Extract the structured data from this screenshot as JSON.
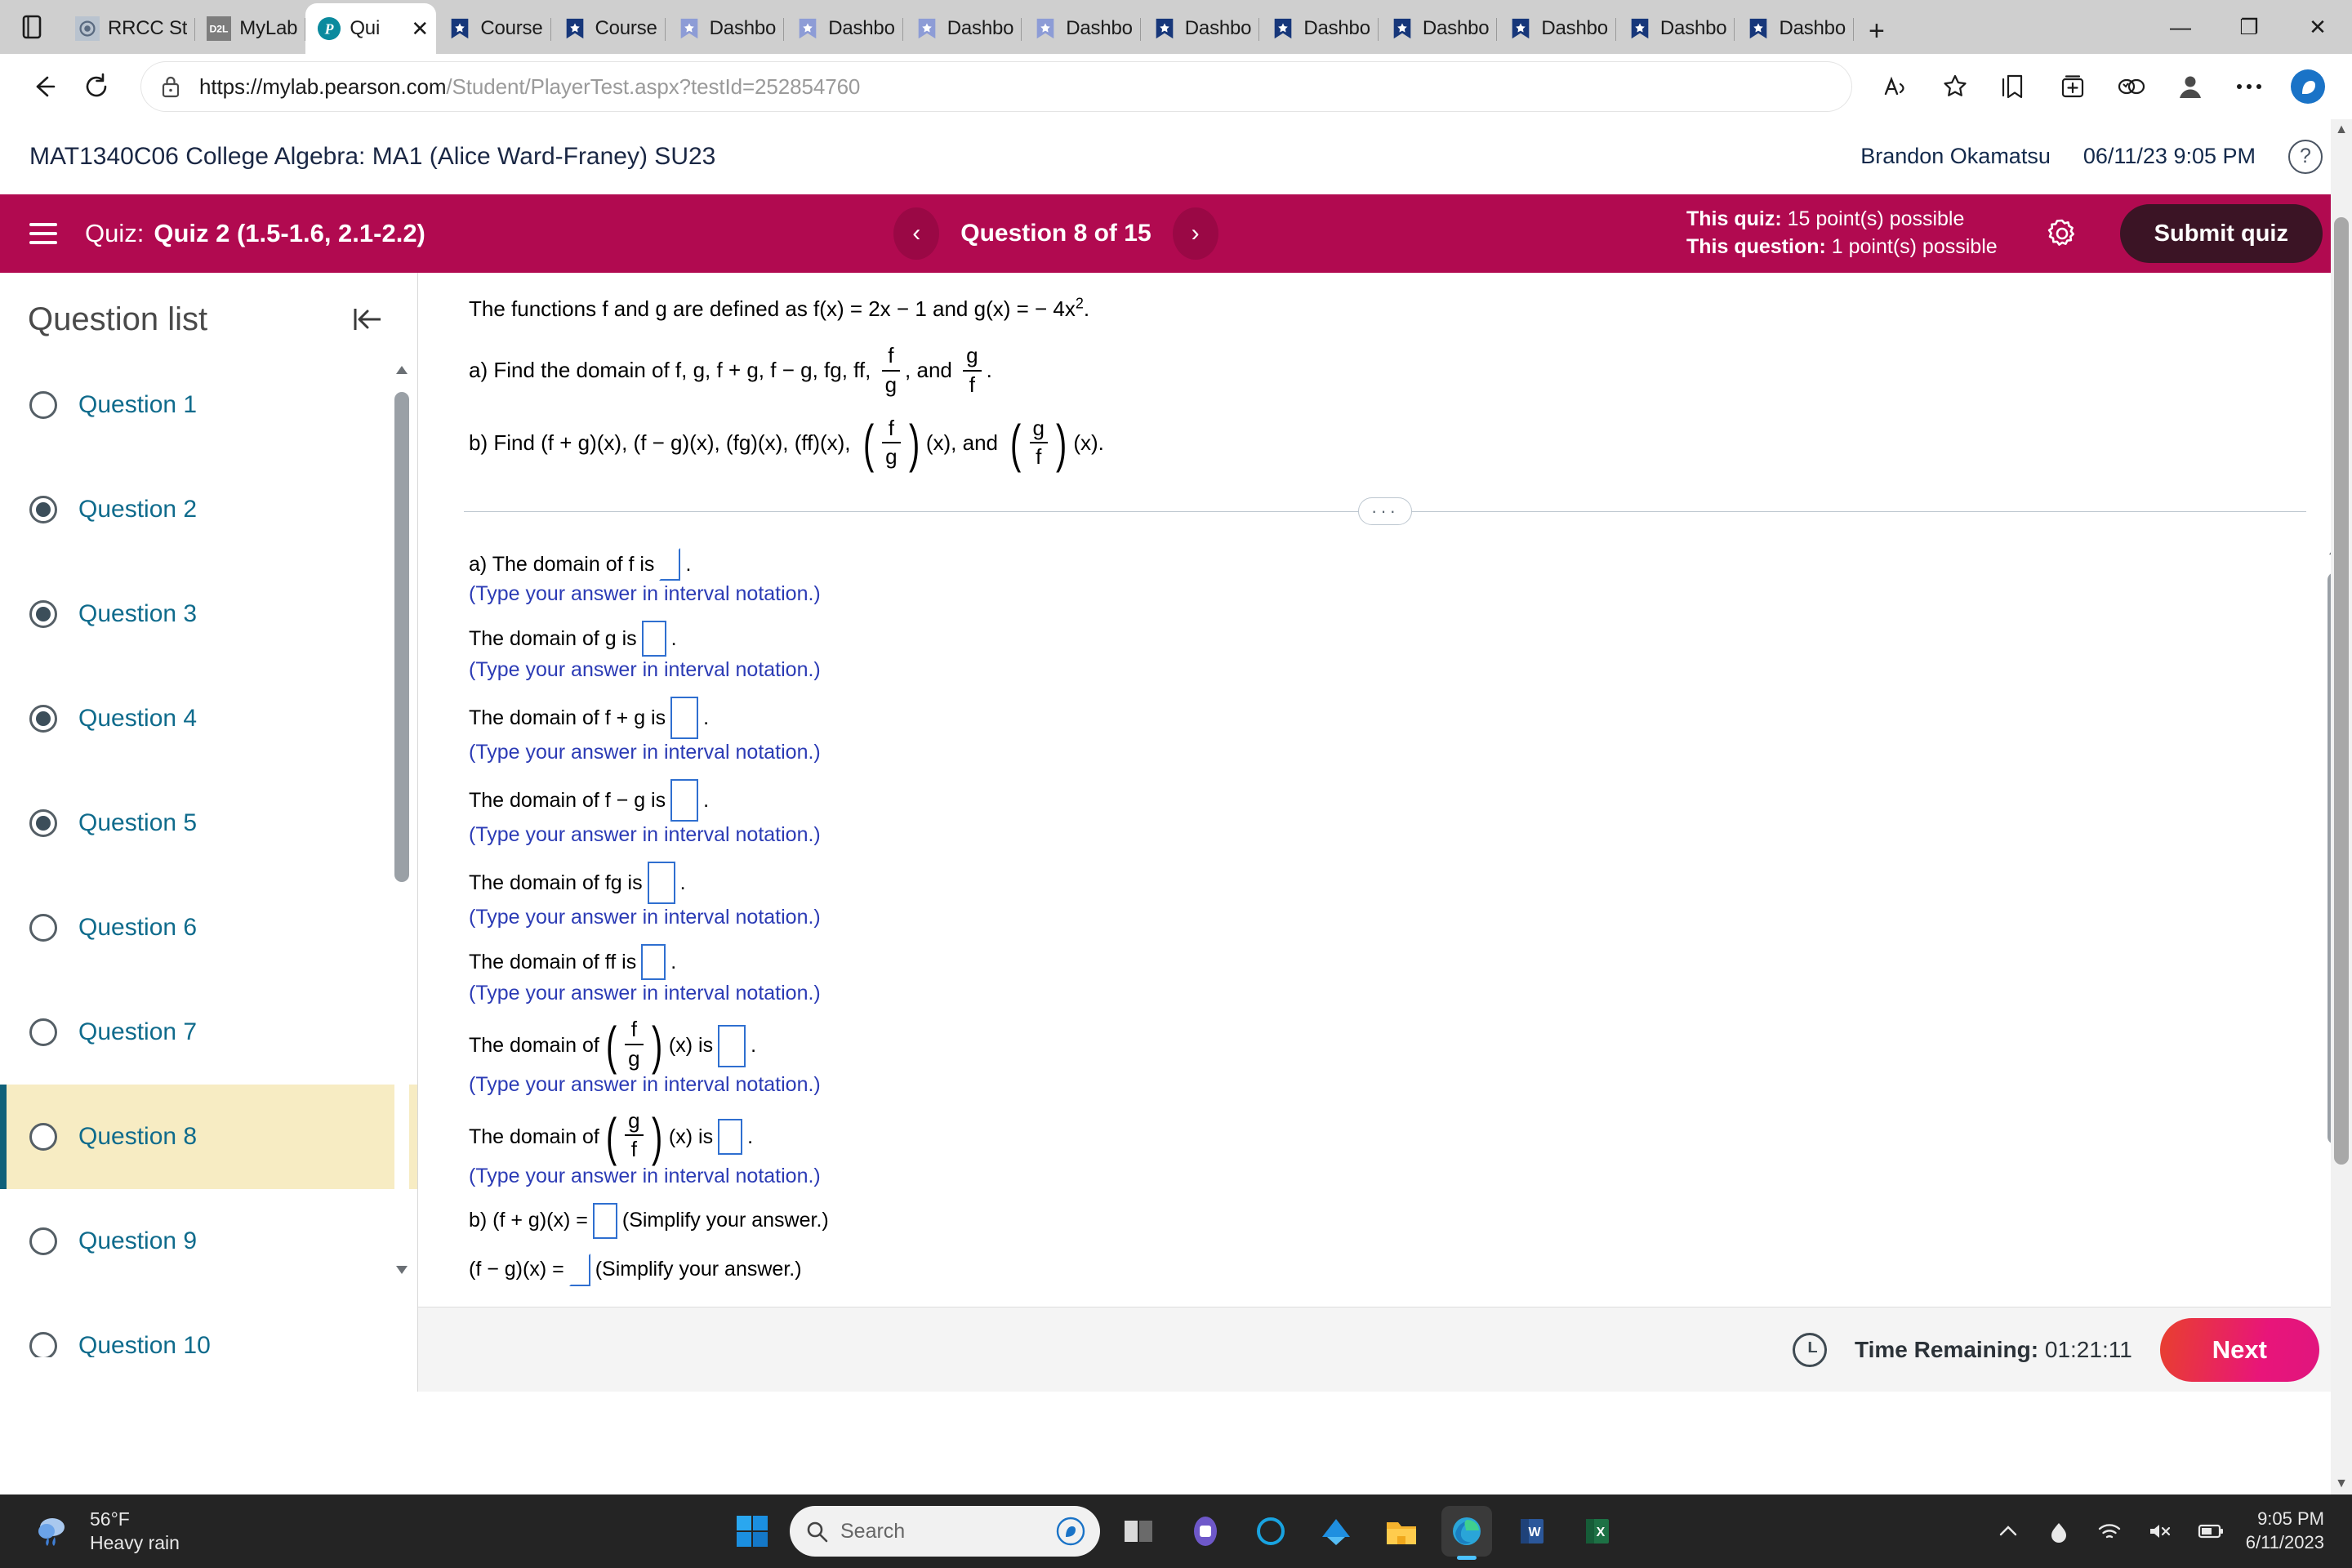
{
  "browser": {
    "tabs": [
      {
        "label": "RRCC St",
        "favicon": "rrcc-seal-icon",
        "active": false
      },
      {
        "label": "MyLab ",
        "favicon": "d2l-icon",
        "active": false
      },
      {
        "label": "Qui",
        "favicon": "pearson-p-icon",
        "active": true
      },
      {
        "label": "Course ",
        "favicon": "blue-banner-icon",
        "active": false
      },
      {
        "label": "Course",
        "favicon": "blue-banner-icon",
        "active": false
      },
      {
        "label": "Dashbo",
        "favicon": "lightblue-banner-icon",
        "active": false
      },
      {
        "label": "Dashbo",
        "favicon": "lightblue-banner-icon",
        "active": false
      },
      {
        "label": "Dashbo",
        "favicon": "lightblue-banner-icon",
        "active": false
      },
      {
        "label": "Dashbo",
        "favicon": "lightblue-banner-icon",
        "active": false
      },
      {
        "label": "Dashbo",
        "favicon": "blue-banner-icon",
        "active": false
      },
      {
        "label": "Dashbo",
        "favicon": "blue-banner-icon",
        "active": false
      },
      {
        "label": "Dashbo",
        "favicon": "blue-banner-icon",
        "active": false
      },
      {
        "label": "Dashbo",
        "favicon": "blue-banner-icon",
        "active": false
      },
      {
        "label": "Dashbo",
        "favicon": "blue-banner-icon",
        "active": false
      },
      {
        "label": "Dashbo",
        "favicon": "blue-banner-icon",
        "active": false
      }
    ],
    "new_tab_label": "+",
    "window_controls": {
      "minimize": "—",
      "maximize": "❐",
      "close": "✕"
    },
    "url_host": "https://mylab.pearson.com",
    "url_path": "/Student/PlayerTest.aspx?testId=252854760",
    "url_full": "https://mylab.pearson.com/Student/PlayerTest.aspx?testId=252854760"
  },
  "course_header": {
    "title": "MAT1340C06 College Algebra: MA1 (Alice Ward-Franey) SU23",
    "user": "Brandon Okamatsu",
    "datetime": "06/11/23 9:05 PM",
    "help_glyph": "?"
  },
  "quiz_bar": {
    "quiz_label": "Quiz:",
    "quiz_name": "Quiz 2 (1.5-1.6, 2.1-2.2)",
    "prev_glyph": "‹",
    "question_counter": "Question 8 of 15",
    "next_glyph": "›",
    "points_quiz_label": "This quiz:",
    "points_quiz_value": " 15 point(s) possible",
    "points_question_label": "This question:",
    "points_question_value": " 1 point(s) possible",
    "submit_label": "Submit quiz",
    "accent_color": "#b10a50",
    "submit_color": "#3b1425"
  },
  "sidebar": {
    "title": "Question list",
    "collapse_glyph": "⇤",
    "questions": [
      {
        "label": "Question 1",
        "answered": false,
        "current": false
      },
      {
        "label": "Question 2",
        "answered": true,
        "current": false
      },
      {
        "label": "Question 3",
        "answered": true,
        "current": false
      },
      {
        "label": "Question 4",
        "answered": true,
        "current": false
      },
      {
        "label": "Question 5",
        "answered": true,
        "current": false
      },
      {
        "label": "Question 6",
        "answered": false,
        "current": false
      },
      {
        "label": "Question 7",
        "answered": false,
        "current": false
      },
      {
        "label": "Question 8",
        "answered": false,
        "current": true
      },
      {
        "label": "Question 9",
        "answered": false,
        "current": false
      },
      {
        "label": "Question 10",
        "answered": false,
        "current": false
      }
    ],
    "highlight_color": "#f7ecc3",
    "current_marker_color": "#10617a",
    "link_color": "#0f6b8c"
  },
  "question": {
    "stem_1_pre": "The functions f and g are defined as f(x) = 2x − 1 and g(x) = − 4x",
    "stem_1_sup": "2",
    "stem_1_post": ".",
    "stem_2_pre": "a) Find the domain of f, g, f + g, f − g, fg, ff, ",
    "stem_2_frac1_num": "f",
    "stem_2_frac1_den": "g",
    "stem_2_mid": ", and ",
    "stem_2_frac2_num": "g",
    "stem_2_frac2_den": "f",
    "stem_2_post": ".",
    "stem_3_pre": "b) Find (f + g)(x), (f − g)(x), (fg)(x), (ff)(x), ",
    "stem_3_frac1_num": "f",
    "stem_3_frac1_den": "g",
    "stem_3_mid": "(x), and ",
    "stem_3_frac2_num": "g",
    "stem_3_frac2_den": "f",
    "stem_3_post": "(x).",
    "collapse_dots": "···"
  },
  "answers": {
    "interval_hint": "(Type your answer in interval notation.)",
    "simplify_hint": "(Simplify your answer.)",
    "rows": [
      {
        "label_pre": "a) The domain of f is",
        "label_post": ".",
        "hint": "interval"
      },
      {
        "label_pre": "The domain of g is",
        "label_post": ".",
        "hint": "interval"
      },
      {
        "label_pre": "The domain of f + g is",
        "label_post": ".",
        "hint": "interval"
      },
      {
        "label_pre": "The domain of f − g is",
        "label_post": ".",
        "hint": "interval"
      },
      {
        "label_pre": "The domain of fg is",
        "label_post": ".",
        "hint": "interval"
      },
      {
        "label_pre": "The domain of ff is",
        "label_post": ".",
        "hint": "interval"
      }
    ],
    "frac_rows": [
      {
        "label_pre": "The domain of",
        "num": "f",
        "den": "g",
        "label_mid": "(x) is",
        "label_post": ".",
        "hint": "interval"
      },
      {
        "label_pre": "The domain of",
        "num": "g",
        "den": "f",
        "label_mid": "(x) is",
        "label_post": ".",
        "hint": "interval"
      }
    ],
    "simplify_rows": [
      {
        "label_pre": "b) (f + g)(x) =",
        "label_post": "(Simplify your answer.)"
      },
      {
        "label_pre": "(f − g)(x) =",
        "label_post": "(Simplify your answer.)"
      }
    ]
  },
  "footer": {
    "time_label": "Time Remaining:",
    "time_value": " 01:21:11",
    "next_label": "Next"
  },
  "taskbar": {
    "weather_temp": "56°F",
    "weather_cond": "Heavy rain",
    "search_placeholder": "Search",
    "clock_time": "9:05 PM",
    "clock_date": "6/11/2023",
    "apps": [
      "task-view-icon",
      "teams-icon",
      "cortana-icon",
      "onedrive-icon",
      "file-explorer-icon",
      "edge-icon",
      "word-icon",
      "excel-icon"
    ],
    "tray": [
      "show-hidden-icons",
      "onedrive-tray-icon",
      "wifi-icon",
      "volume-muted-icon",
      "battery-icon"
    ]
  }
}
